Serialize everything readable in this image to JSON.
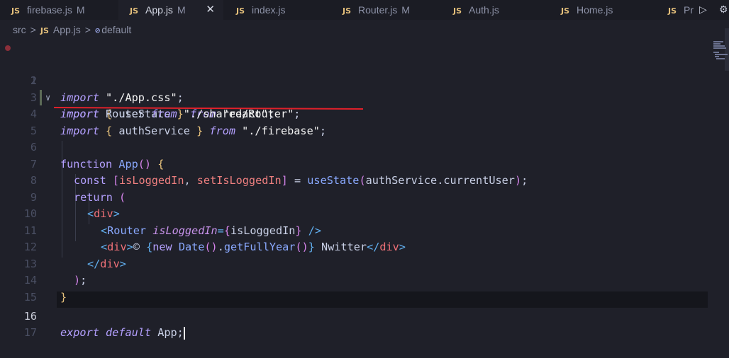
{
  "tabs": [
    {
      "icon": "JS",
      "name": "firebase.js",
      "mod": "M"
    },
    {
      "icon": "JS",
      "name": "App.js",
      "mod": "M",
      "active": true
    },
    {
      "icon": "JS",
      "name": "index.js",
      "mod": ""
    },
    {
      "icon": "JS",
      "name": "Router.js",
      "mod": "M"
    },
    {
      "icon": "JS",
      "name": "Auth.js",
      "mod": ""
    },
    {
      "icon": "JS",
      "name": "Home.js",
      "mod": ""
    },
    {
      "icon": "JS",
      "name": "Pr",
      "mod": ""
    }
  ],
  "close_glyph": "✕",
  "run_glyph": "▷",
  "gear_glyph": "⚙",
  "breadcrumb": {
    "folder": "src",
    "sep": ">",
    "js": "JS",
    "file": "App.js",
    "sym_icon": "⊘",
    "symbol": "default"
  },
  "fold_glyph": "∨",
  "lines": {
    "n1": "1",
    "n2": "2",
    "n3": "3",
    "n4": "4",
    "n5": "5",
    "n6": "6",
    "n7": "7",
    "n8": "8",
    "n9": "9",
    "n10": "10",
    "n11": "11",
    "n12": "12",
    "n13": "13",
    "n14": "14",
    "n15": "15",
    "n16": "16",
    "n17": "17",
    "import": "import",
    "from": "from",
    "function": "function",
    "const": "const",
    "return": "return",
    "export": "export",
    "default": "default",
    "new": "new",
    "lb": "{",
    "rb": "}",
    "useState": "useState",
    "react": "\"react\"",
    "semi": ";",
    "appcss": "\"./App.css\"",
    "router": "Router",
    "routerpath": "\"./shared/Router\"",
    "authService": "authService",
    "firebase": "\"./firebase\"",
    "App": "App",
    "parens": "()",
    "lp": "(",
    "rp": ")",
    "lsq": "[",
    "rsq": "]",
    "comma": ",",
    "eq": "=",
    "isLoggedIn": "isLoggedIn",
    "setIsLoggedIn": "setIsLoggedIn",
    "dot": ".",
    "currentUser": "currentUser",
    "lt": "<",
    "gt": ">",
    "div": "div",
    "closeslash": "</",
    "selfclose": "/>",
    "attr_eq": "=",
    "copy": "©",
    "Date": "Date",
    "getFullYear": "getFullYear",
    "nwitter": "Nwitter"
  },
  "annotation_color": "#e0202a"
}
